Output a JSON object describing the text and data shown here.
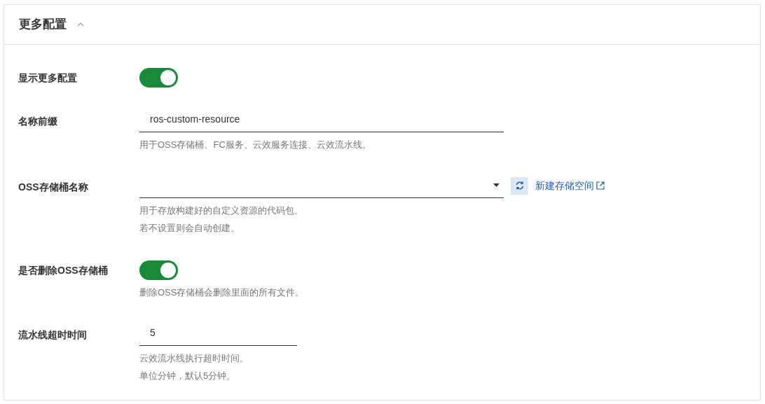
{
  "section": {
    "title": "更多配置",
    "expanded": true
  },
  "fields": [
    {
      "kind": "switch",
      "label": "显示更多配置",
      "on": true
    },
    {
      "kind": "text",
      "label": "名称前缀",
      "value": "ros-custom-resource",
      "hints": [
        "用于OSS存储桶、FC服务、云效服务连接、云效流水线。"
      ]
    },
    {
      "kind": "select",
      "label": "OSS存储桶名称",
      "link": "新建存储空间",
      "hints": [
        "用于存放构建好的自定义资源的代码包。",
        "若不设置则会自动创建。"
      ]
    },
    {
      "kind": "switch",
      "label": "是否删除OSS存储桶",
      "on": true,
      "hints": [
        "删除OSS存储桶会删除里面的所有文件。"
      ]
    },
    {
      "kind": "number",
      "label": "流水线超时时间",
      "value": "5",
      "hints": [
        "云效流水线执行超时时间。",
        "单位分钟，默认5分钟。"
      ]
    }
  ]
}
